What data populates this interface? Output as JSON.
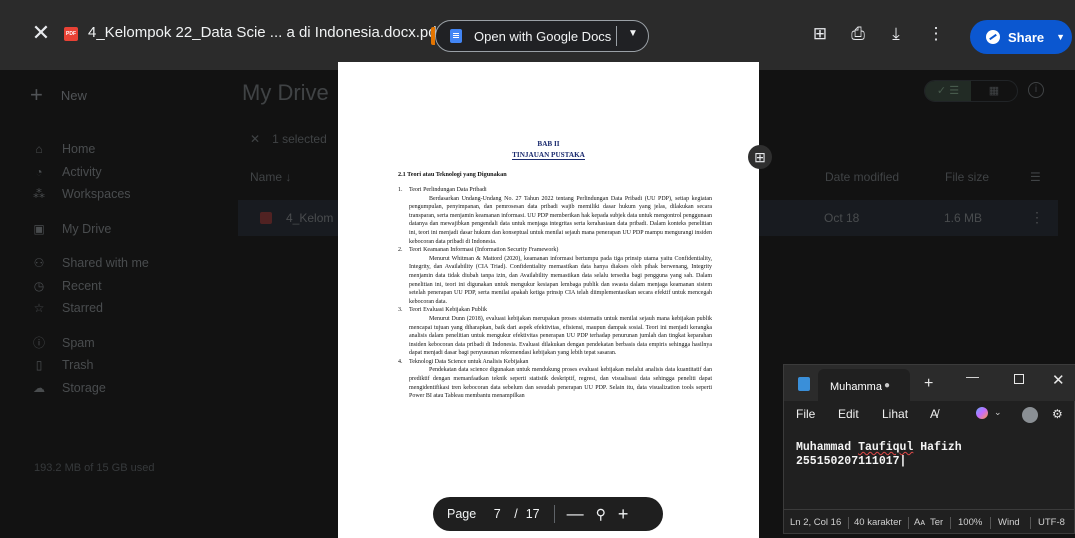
{
  "viewer": {
    "title": "4_Kelompok 22_Data Scie ... a di Indonesia.docx.pdf",
    "pdf_badge": "PDF",
    "open_with_label": "Open with Google Docs",
    "share_label": "Share",
    "share_color": "#0b57d0"
  },
  "drive": {
    "new_label": "New",
    "title": "My Drive",
    "nav": [
      {
        "label": "Home",
        "icon": "home-icon"
      },
      {
        "label": "Activity",
        "icon": "bell-icon"
      },
      {
        "label": "Workspaces",
        "icon": "workspaces-icon"
      },
      {
        "label": "My Drive",
        "icon": "drive-icon"
      },
      {
        "label": "Shared with me",
        "icon": "people-icon"
      },
      {
        "label": "Recent",
        "icon": "clock-icon"
      },
      {
        "label": "Starred",
        "icon": "star-icon"
      },
      {
        "label": "Spam",
        "icon": "spam-icon"
      },
      {
        "label": "Trash",
        "icon": "trash-icon"
      },
      {
        "label": "Storage",
        "icon": "cloud-icon"
      }
    ],
    "selected_text": "1 selected",
    "columns": {
      "name": "Name",
      "date": "Date modified",
      "size": "File size"
    },
    "row": {
      "name": "4_Kelom",
      "date": "Oct 18",
      "size": "1.6 MB"
    },
    "storage_text": "193.2 MB of 15 GB used"
  },
  "pdf": {
    "bab": "BAB II",
    "tinjauan": "TINJAUAN PUSTAKA",
    "heading": "2.1 Teori atau Teknologi yang Digunakan",
    "items": [
      {
        "num": "1.",
        "title": "Teori Perlindungan Data Pribadi",
        "text": "Berdasarkan Undang-Undang No. 27 Tahun 2022 tentang Perlindungan Data Pribadi (UU PDP), setiap kegiatan pengumpulan, penyimpanan, dan pemrosesan data pribadi wajib memiliki dasar hukum yang jelas, dilakukan secara transparan, serta menjamin keamanan informasi. UU PDP memberikan hak kepada subjek data untuk mengontrol penggunaan datanya dan mewajibkan pengendali data untuk menjaga integritas serta kerahasiaan data pribadi. Dalam konteks penelitian ini, teori ini menjadi dasar hukum dan konseptual untuk menilai sejauh mana penerapan UU PDP mampu mengurangi insiden kebocoran data pribadi di Indonesia."
      },
      {
        "num": "2.",
        "title": "Teori Keamanan Informasi (Information Security Framework)",
        "text": "Menurut Whitman & Mattord (2020), keamanan informasi bertumpu pada tiga prinsip utama yaitu Confidentiality, Integrity, dan Availability (CIA Triad). Confidentiality memastikan data hanya diakses oleh pihak berwenang, Integrity menjamin data tidak diubah tanpa izin, dan Availability memastikan data selalu tersedia bagi pengguna yang sah. Dalam penelitian ini, teori ini digunakan untuk mengukur kesiapan lembaga publik dan swasta dalam menjaga keamanan sistem setelah penerapan UU PDP, serta menilai apakah ketiga prinsip CIA telah diimplementasikan secara efektif untuk mencegah kebocoran data."
      },
      {
        "num": "3.",
        "title": "Teori Evaluasi Kebijakan Publik",
        "text": "Menurut Dunn (2018), evaluasi kebijakan merupakan proses sistematis untuk menilai sejauh mana kebijakan publik mencapai tujuan yang diharapkan, baik dari aspek efektivitas, efisiensi, maupun dampak sosial. Teori ini menjadi kerangka analisis dalam penelitian untuk mengukur efektivitas penerapan UU PDP terhadap penurunan jumlah dan tingkat keparahan insiden kebocoran data pribadi di Indonesia. Evaluasi dilakukan dengan pendekatan berbasis data empiris sehingga hasilnya dapat menjadi dasar bagi penyusunan rekomendasi kebijakan yang lebih tepat sasaran."
      },
      {
        "num": "4.",
        "title": "Teknologi Data Science untuk Analisis Kebijakan",
        "text": "Pendekatan data science digunakan untuk mendukung proses evaluasi kebijakan melalui analisis data kuantitatif dan prediktif dengan memanfaatkan teknik seperti statistik deskriptif, regresi, dan visualisasi data sehingga peneliti dapat mengidentifikasi tren kebocoran data sebelum dan sesudah penerapan UU PDP. Selain itu, data visualization tools seperti Power BI atau Tableau membantu menampilkan"
      }
    ]
  },
  "page_nav": {
    "label": "Page",
    "current": "7",
    "separator": "/",
    "total": "17"
  },
  "notepad": {
    "tab_title": "Muhamma",
    "menu": {
      "file": "File",
      "edit": "Edit",
      "view": "Lihat",
      "format": "A̸"
    },
    "line1_first": "Muhammad ",
    "line1_underlined": "Taufiqul",
    "line1_rest": " Hafizh",
    "line2": "255150207111017",
    "status": {
      "position": "Ln 2, Col 16",
      "chars": "40 karakter",
      "font": "Ter",
      "zoom": "100%",
      "line_ending": "Wind",
      "encoding": "UTF-8"
    }
  }
}
